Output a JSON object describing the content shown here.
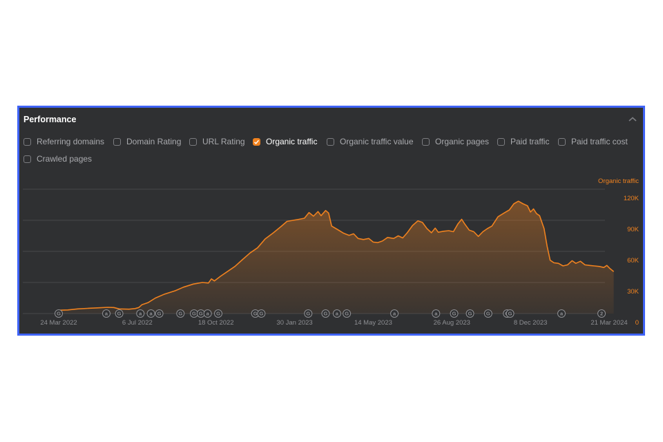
{
  "panel": {
    "title": "Performance",
    "collapse_icon": "chevron-up-icon",
    "border_color": "#3f63f6",
    "background": "#2f3032"
  },
  "filters": [
    {
      "label": "Referring domains",
      "checked": false
    },
    {
      "label": "Domain Rating",
      "checked": false
    },
    {
      "label": "URL Rating",
      "checked": false
    },
    {
      "label": "Organic traffic",
      "checked": true
    },
    {
      "label": "Organic traffic value",
      "checked": false
    },
    {
      "label": "Organic pages",
      "checked": false
    },
    {
      "label": "Paid traffic",
      "checked": false
    },
    {
      "label": "Paid traffic cost",
      "checked": false
    },
    {
      "label": "Crawled pages",
      "checked": false
    }
  ],
  "colors": {
    "accent": "#f0821f",
    "grid": "#47484b",
    "muted_text": "#8e8f93"
  },
  "chart_data": {
    "type": "area",
    "title": "Organic traffic",
    "series_label": "Organic traffic",
    "xlabel": "",
    "ylabel": "Organic traffic",
    "ylim": [
      0,
      120000
    ],
    "y_axis_position": "right",
    "grid": true,
    "yticks": [
      {
        "value": 0,
        "label": "0"
      },
      {
        "value": 30000,
        "label": "30K"
      },
      {
        "value": 60000,
        "label": "60K"
      },
      {
        "value": 90000,
        "label": "90K"
      },
      {
        "value": 120000,
        "label": "120K"
      }
    ],
    "x_range": [
      "2022-03-10",
      "2024-04-01"
    ],
    "xticks": [
      {
        "date": "2022-03-24",
        "label": "24 Mar 2022"
      },
      {
        "date": "2022-07-06",
        "label": "6 Jul 2022"
      },
      {
        "date": "2022-10-18",
        "label": "18 Oct 2022"
      },
      {
        "date": "2023-01-30",
        "label": "30 Jan 2023"
      },
      {
        "date": "2023-05-14",
        "label": "14 May 2023"
      },
      {
        "date": "2023-08-26",
        "label": "26 Aug 2023"
      },
      {
        "date": "2023-12-08",
        "label": "8 Dec 2023"
      },
      {
        "date": "2024-03-21",
        "label": "21 Mar 2024"
      }
    ],
    "series": [
      {
        "name": "Organic traffic",
        "points": [
          [
            "2022-03-24",
            3200
          ],
          [
            "2022-04-05",
            3500
          ],
          [
            "2022-04-18",
            4500
          ],
          [
            "2022-05-01",
            5000
          ],
          [
            "2022-05-14",
            5500
          ],
          [
            "2022-05-28",
            6000
          ],
          [
            "2022-06-05",
            5800
          ],
          [
            "2022-06-12",
            4500
          ],
          [
            "2022-06-25",
            4200
          ],
          [
            "2022-07-03",
            4800
          ],
          [
            "2022-07-08",
            5800
          ],
          [
            "2022-07-12",
            8500
          ],
          [
            "2022-07-20",
            10500
          ],
          [
            "2022-07-30",
            15000
          ],
          [
            "2022-08-10",
            18500
          ],
          [
            "2022-08-25",
            22000
          ],
          [
            "2022-09-05",
            25500
          ],
          [
            "2022-09-18",
            28500
          ],
          [
            "2022-09-30",
            30000
          ],
          [
            "2022-10-08",
            29500
          ],
          [
            "2022-10-12",
            33500
          ],
          [
            "2022-10-16",
            31500
          ],
          [
            "2022-10-24",
            36000
          ],
          [
            "2022-11-02",
            40500
          ],
          [
            "2022-11-12",
            45500
          ],
          [
            "2022-11-22",
            52000
          ],
          [
            "2022-12-02",
            58500
          ],
          [
            "2022-12-12",
            63500
          ],
          [
            "2022-12-22",
            72000
          ],
          [
            "2023-01-02",
            78000
          ],
          [
            "2023-01-12",
            84000
          ],
          [
            "2023-01-20",
            89000
          ],
          [
            "2023-01-28",
            90000
          ],
          [
            "2023-02-05",
            91000
          ],
          [
            "2023-02-12",
            92000
          ],
          [
            "2023-02-18",
            97500
          ],
          [
            "2023-02-24",
            94000
          ],
          [
            "2023-03-02",
            98500
          ],
          [
            "2023-03-06",
            94500
          ],
          [
            "2023-03-12",
            99500
          ],
          [
            "2023-03-16",
            97000
          ],
          [
            "2023-03-20",
            84500
          ],
          [
            "2023-03-28",
            81000
          ],
          [
            "2023-04-05",
            77500
          ],
          [
            "2023-04-12",
            75500
          ],
          [
            "2023-04-18",
            77000
          ],
          [
            "2023-04-24",
            72500
          ],
          [
            "2023-05-01",
            71500
          ],
          [
            "2023-05-08",
            72500
          ],
          [
            "2023-05-14",
            69000
          ],
          [
            "2023-05-20",
            68500
          ],
          [
            "2023-05-26",
            70000
          ],
          [
            "2023-06-02",
            73500
          ],
          [
            "2023-06-10",
            72500
          ],
          [
            "2023-06-16",
            75000
          ],
          [
            "2023-06-22",
            73000
          ],
          [
            "2023-06-28",
            78000
          ],
          [
            "2023-07-05",
            85000
          ],
          [
            "2023-07-12",
            89500
          ],
          [
            "2023-07-18",
            88000
          ],
          [
            "2023-07-24",
            82000
          ],
          [
            "2023-07-30",
            78000
          ],
          [
            "2023-08-04",
            82500
          ],
          [
            "2023-08-08",
            78500
          ],
          [
            "2023-08-15",
            79500
          ],
          [
            "2023-08-22",
            80000
          ],
          [
            "2023-08-28",
            79000
          ],
          [
            "2023-09-03",
            86500
          ],
          [
            "2023-09-08",
            91000
          ],
          [
            "2023-09-12",
            86500
          ],
          [
            "2023-09-18",
            80500
          ],
          [
            "2023-09-24",
            79000
          ],
          [
            "2023-09-30",
            74500
          ],
          [
            "2023-10-06",
            79000
          ],
          [
            "2023-10-12",
            82000
          ],
          [
            "2023-10-18",
            84500
          ],
          [
            "2023-10-26",
            93500
          ],
          [
            "2023-11-04",
            97500
          ],
          [
            "2023-11-10",
            100000
          ],
          [
            "2023-11-16",
            106000
          ],
          [
            "2023-11-22",
            108500
          ],
          [
            "2023-11-28",
            106000
          ],
          [
            "2023-12-04",
            104000
          ],
          [
            "2023-12-08",
            98000
          ],
          [
            "2023-12-12",
            101000
          ],
          [
            "2023-12-16",
            96500
          ],
          [
            "2023-12-20",
            94500
          ],
          [
            "2023-12-26",
            82000
          ],
          [
            "2023-12-30",
            65000
          ],
          [
            "2024-01-03",
            51500
          ],
          [
            "2024-01-08",
            49000
          ],
          [
            "2024-01-14",
            48500
          ],
          [
            "2024-01-20",
            46000
          ],
          [
            "2024-01-26",
            47000
          ],
          [
            "2024-02-01",
            51000
          ],
          [
            "2024-02-06",
            48500
          ],
          [
            "2024-02-12",
            50500
          ],
          [
            "2024-02-18",
            47000
          ],
          [
            "2024-02-24",
            46500
          ],
          [
            "2024-03-01",
            46000
          ],
          [
            "2024-03-08",
            45500
          ],
          [
            "2024-03-14",
            44500
          ],
          [
            "2024-03-18",
            46500
          ],
          [
            "2024-03-22",
            43500
          ],
          [
            "2024-03-27",
            40500
          ]
        ]
      }
    ],
    "annotations": [
      {
        "date": "2022-03-24",
        "label": "G"
      },
      {
        "date": "2022-05-26",
        "label": "a"
      },
      {
        "date": "2022-06-12",
        "label": "G"
      },
      {
        "date": "2022-07-10",
        "label": "a"
      },
      {
        "date": "2022-07-24",
        "label": "a"
      },
      {
        "date": "2022-08-04",
        "label": "G"
      },
      {
        "date": "2022-09-01",
        "label": "G"
      },
      {
        "date": "2022-09-19",
        "label": "G"
      },
      {
        "date": "2022-09-28",
        "label": "G"
      },
      {
        "date": "2022-10-07",
        "label": "a"
      },
      {
        "date": "2022-10-21",
        "label": "G"
      },
      {
        "date": "2022-12-09",
        "label": "G"
      },
      {
        "date": "2022-12-17",
        "label": "G"
      },
      {
        "date": "2023-02-17",
        "label": "G"
      },
      {
        "date": "2023-03-12",
        "label": "G"
      },
      {
        "date": "2023-03-27",
        "label": "a"
      },
      {
        "date": "2023-04-09",
        "label": "G"
      },
      {
        "date": "2023-06-11",
        "label": "a"
      },
      {
        "date": "2023-08-05",
        "label": "a"
      },
      {
        "date": "2023-08-29",
        "label": "G"
      },
      {
        "date": "2023-09-19",
        "label": "G"
      },
      {
        "date": "2023-10-13",
        "label": "G"
      },
      {
        "date": "2023-11-07",
        "label": "G"
      },
      {
        "date": "2023-11-11",
        "label": "G"
      },
      {
        "date": "2024-01-18",
        "label": "a"
      },
      {
        "date": "2024-03-11",
        "label": "2"
      }
    ]
  }
}
